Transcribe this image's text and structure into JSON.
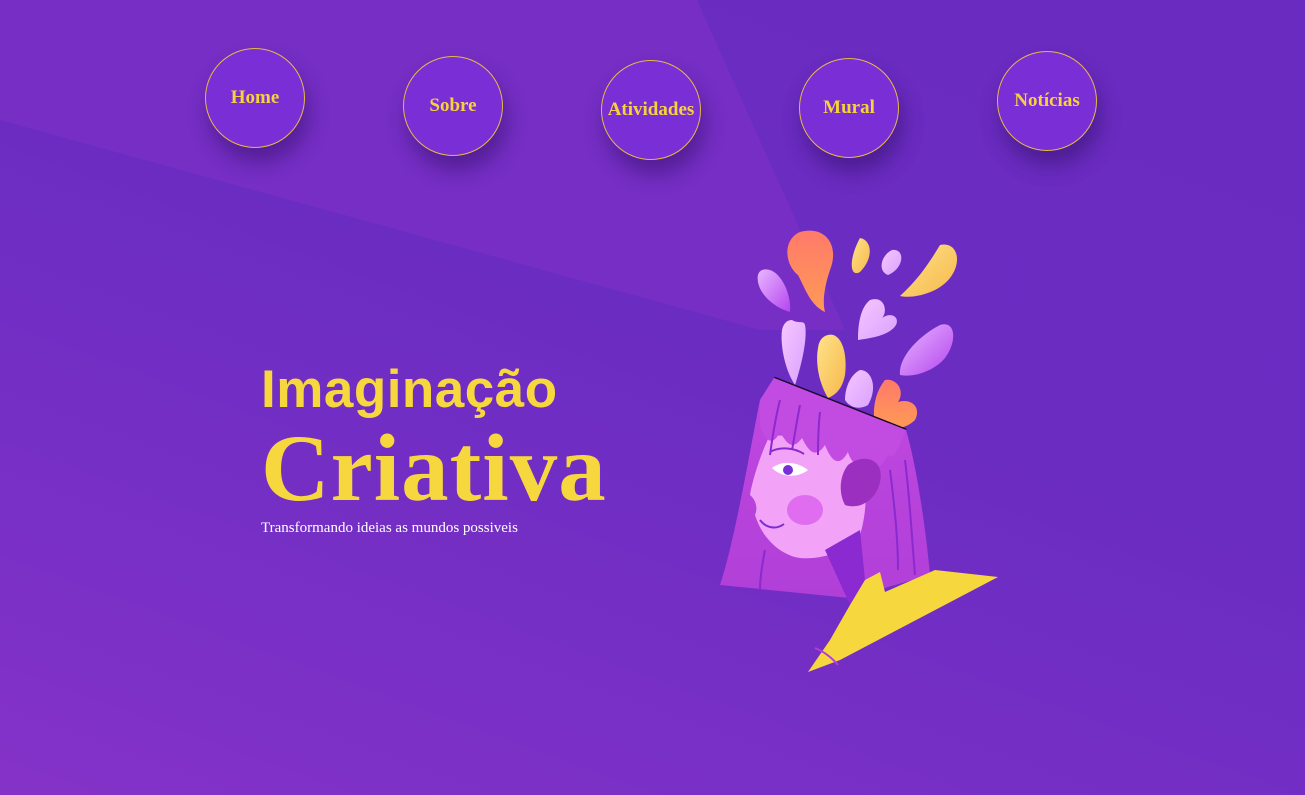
{
  "nav": {
    "items": [
      {
        "label": "Home"
      },
      {
        "label": "Sobre"
      },
      {
        "label": "Atividades"
      },
      {
        "label": "Mural"
      },
      {
        "label": "Notícias"
      }
    ]
  },
  "hero": {
    "title_line1": "Imaginação",
    "title_line2": "Criativa",
    "subtitle": "Transformando ideias as mundos possiveis"
  },
  "colors": {
    "background": "#6b2cc2",
    "accent_yellow": "#f7d73e",
    "nav_circle": "#7a2ed6",
    "nav_border": "#e6b94a"
  },
  "icons": {
    "illustration": "creative-head-illustration"
  }
}
